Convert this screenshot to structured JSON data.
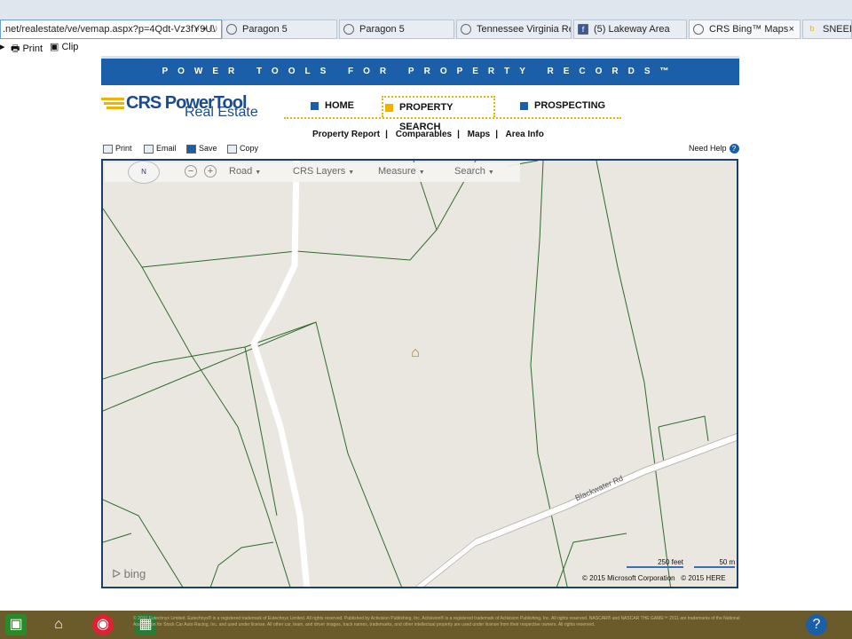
{
  "browser": {
    "address": ".net/realestate/ve/vemap.aspx?p=4Qdt-Vz3fY9U\\",
    "tabs": [
      "Paragon 5",
      "Paragon 5",
      "Tennessee Virginia Regi...",
      "(5) Lakeway Area",
      "CRS Bing™ Maps",
      "SNEEDVI"
    ],
    "commands": {
      "print": "Print",
      "clip": "Clip"
    }
  },
  "banner": {
    "text": "POWER TOOLS FOR PROPERTY RECORDS™"
  },
  "logo": {
    "line1": "CRS PowerTool",
    "line2": "Real Estate"
  },
  "nav": [
    {
      "label": "HOME",
      "active": false
    },
    {
      "label": "PROPERTY SEARCH",
      "active": true
    },
    {
      "label": "PROSPECTING",
      "active": false
    }
  ],
  "subnav": [
    "Property Report",
    "Comparables",
    "Maps",
    "Area Info"
  ],
  "tools": [
    "Print",
    "Email",
    "Save",
    "Copy"
  ],
  "help": "Need Help",
  "map": {
    "compass": "N",
    "view": "Road",
    "layers": "CRS Layers",
    "measure": "Measure",
    "search": "Search",
    "road_label": "Blackwater Rd",
    "bing": "bing",
    "scale_feet": "250 feet",
    "scale_m": "50 m",
    "copy1": "© 2015 Microsoft Corporation",
    "copy2": "© 2015 HERE"
  },
  "taskbar": {
    "legal": "© 2010 Eutechnyx Limited. Eutechnyx® is a registered trademark of Eutechnyx Limited. All rights reserved. Published by Activision Publishing, Inc. Activision® is a registered trademark of Activision Publishing, Inc. All rights reserved. NASCAR® and NASCAR THE GAME™ 2011 are trademarks of the National Association for Stock Car Auto Racing, Inc. and used under license. All other car, team, and driver images, track names, trademarks, and other intellectual property are used under license from their respective owners. All rights reserved."
  },
  "colors": {
    "brand_blue": "#1a5fa8",
    "accent_gold": "#f0b400",
    "parcel_line": "#2e6b2e",
    "map_bg": "#eae7e0"
  }
}
